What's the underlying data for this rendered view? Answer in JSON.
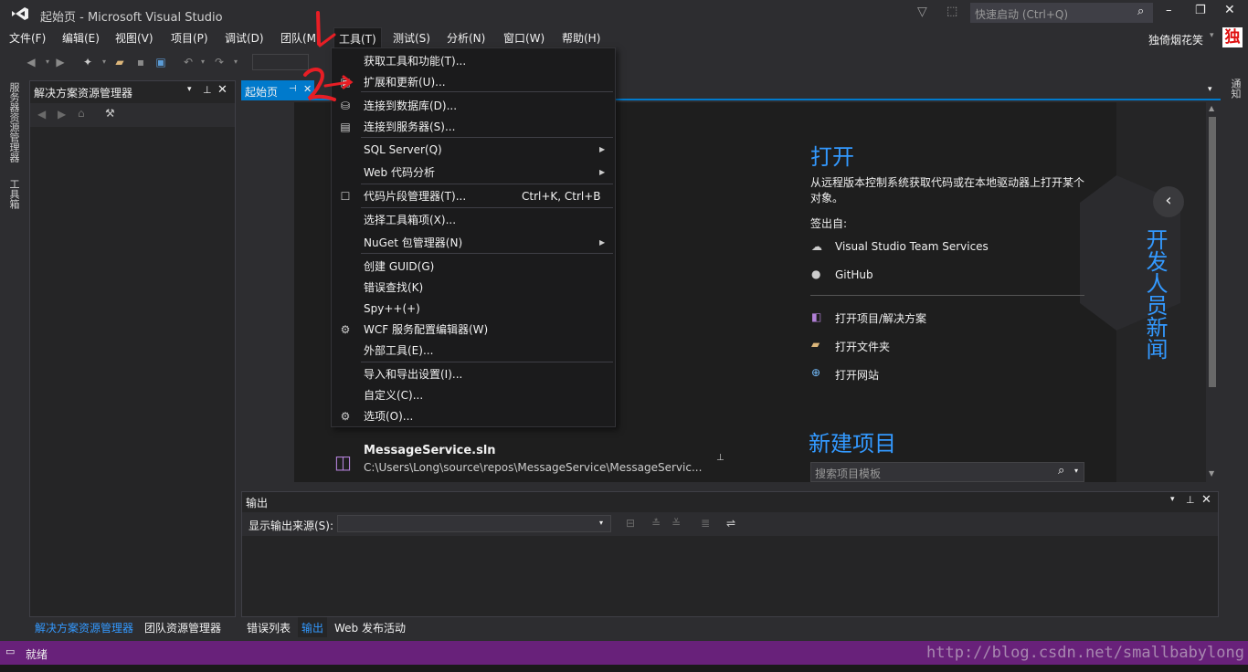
{
  "window": {
    "title": "起始页 - Microsoft Visual Studio",
    "quick_launch_placeholder": "快速启动 (Ctrl+Q)",
    "user_name": "独倚烟花笑",
    "user_avatar": "独"
  },
  "menu": [
    "文件(F)",
    "编辑(E)",
    "视图(V)",
    "项目(P)",
    "调试(D)",
    "团队(M)",
    "工具(T)",
    "测试(S)",
    "分析(N)",
    "窗口(W)",
    "帮助(H)"
  ],
  "annotations": {
    "one": "1",
    "two": "2"
  },
  "left_strip": {
    "server_explorer": "服务器资源管理器",
    "toolbox": "工具箱"
  },
  "right_strip": {
    "notifications": "通知"
  },
  "solution_explorer": {
    "title": "解决方案资源管理器"
  },
  "doc_tab": {
    "label": "起始页"
  },
  "tools_menu": {
    "items": [
      {
        "label": "获取工具和功能(T)...",
        "shortcut": "",
        "submenu": false,
        "icon": ""
      },
      {
        "label": "扩展和更新(U)...",
        "shortcut": "",
        "submenu": false,
        "icon": "extensions-icon"
      },
      {
        "label": "连接到数据库(D)...",
        "shortcut": "",
        "submenu": false,
        "icon": "database-icon"
      },
      {
        "label": "连接到服务器(S)...",
        "shortcut": "",
        "submenu": false,
        "icon": "server-icon"
      },
      {
        "label": "SQL Server(Q)",
        "shortcut": "",
        "submenu": true,
        "icon": ""
      },
      {
        "label": "Web 代码分析",
        "shortcut": "",
        "submenu": true,
        "icon": ""
      },
      {
        "label": "代码片段管理器(T)...",
        "shortcut": "Ctrl+K, Ctrl+B",
        "submenu": false,
        "icon": "snippet-icon"
      },
      {
        "label": "选择工具箱项(X)...",
        "shortcut": "",
        "submenu": false,
        "icon": ""
      },
      {
        "label": "NuGet 包管理器(N)",
        "shortcut": "",
        "submenu": true,
        "icon": ""
      },
      {
        "label": "创建 GUID(G)",
        "shortcut": "",
        "submenu": false,
        "icon": ""
      },
      {
        "label": "错误查找(K)",
        "shortcut": "",
        "submenu": false,
        "icon": ""
      },
      {
        "label": "Spy++(+)",
        "shortcut": "",
        "submenu": false,
        "icon": ""
      },
      {
        "label": "WCF 服务配置编辑器(W)",
        "shortcut": "",
        "submenu": false,
        "icon": "wcf-icon"
      },
      {
        "label": "外部工具(E)...",
        "shortcut": "",
        "submenu": false,
        "icon": ""
      },
      {
        "label": "导入和导出设置(I)...",
        "shortcut": "",
        "submenu": false,
        "icon": ""
      },
      {
        "label": "自定义(C)...",
        "shortcut": "",
        "submenu": false,
        "icon": ""
      },
      {
        "label": "选项(O)...",
        "shortcut": "",
        "submenu": false,
        "icon": "gear-icon"
      }
    ]
  },
  "start_page": {
    "open_heading": "打开",
    "open_desc": "从远程版本控制系统获取代码或在本地驱动器上打开某个对象。",
    "checkout_from": "签出自:",
    "vsts": "Visual Studio Team Services",
    "github": "GitHub",
    "open_project": "打开项目/解决方案",
    "open_folder": "打开文件夹",
    "open_website": "打开网站",
    "new_project_heading": "新建项目",
    "search_templates_placeholder": "搜索项目模板",
    "developer_news": "开发人员新闻",
    "recent_name": "MessageService.sln",
    "recent_path": "C:\\Users\\Long\\source\\repos\\MessageService\\MessageServic..."
  },
  "output": {
    "title": "输出",
    "show_source_label": "显示输出来源(S):"
  },
  "bottom_tabs_left": [
    "解决方案资源管理器",
    "团队资源管理器"
  ],
  "bottom_tabs_right": [
    "错误列表",
    "输出",
    "Web 发布活动"
  ],
  "status": {
    "text": "就绪",
    "watermark": "http://blog.csdn.net/smallbabylong"
  }
}
